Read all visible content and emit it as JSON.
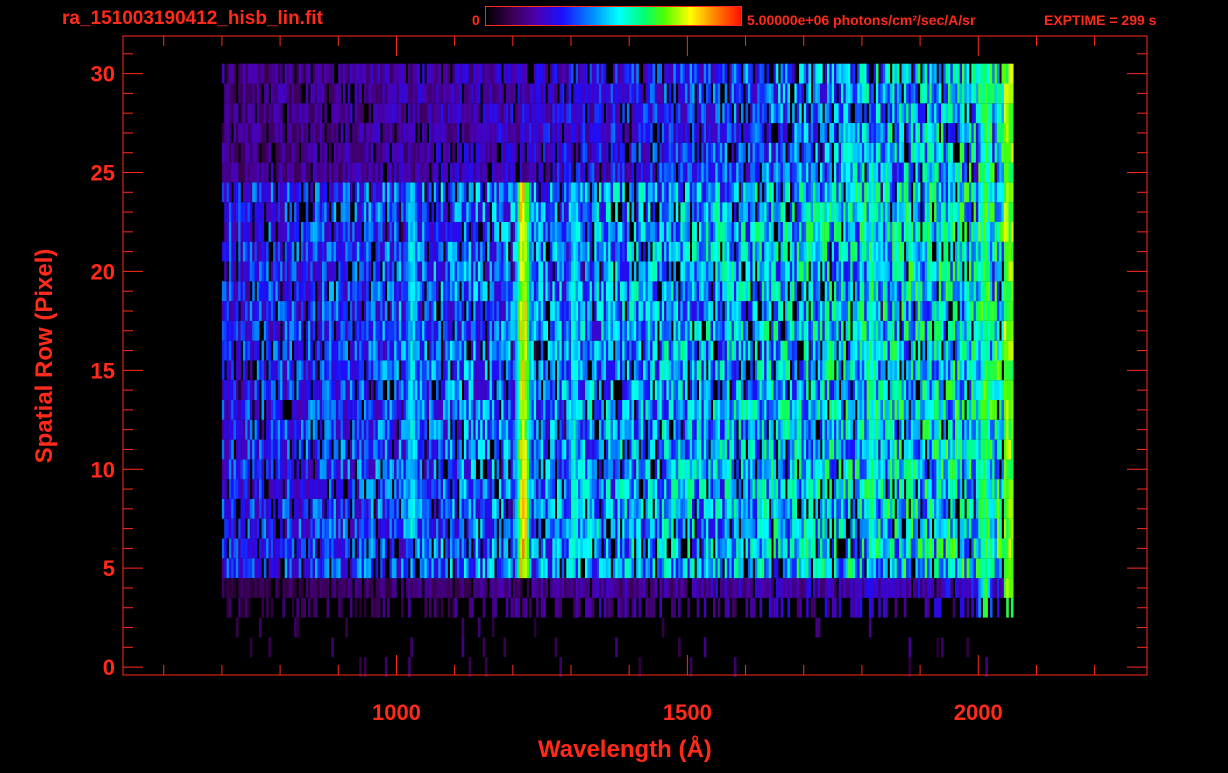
{
  "header": {
    "file_title": "ra_151003190412_hisb_lin.fit",
    "colorbar_min": "0",
    "colorbar_max": "5.00000e+06 photons/cm²/sec/A/sr",
    "exptime": "EXPTIME = 299 s"
  },
  "colors": {
    "text": "#ff2a1a",
    "axis": "#ff2a1a",
    "background": "#000000",
    "colormap": [
      "#000000",
      "#3a0050",
      "#4b00b4",
      "#1a10ff",
      "#0090ff",
      "#00ffff",
      "#00ff70",
      "#50ff00",
      "#ffff00",
      "#ff8000",
      "#ff1000"
    ]
  },
  "chart_data": {
    "type": "heatmap",
    "title": "ra_151003190412_hisb_lin.fit",
    "xlabel": "Wavelength (Å)",
    "ylabel": "Spatial Row (Pixel)",
    "xlim": [
      530,
      2290
    ],
    "ylim": [
      -0.4,
      31.9
    ],
    "x_ticks": [
      1000,
      1500,
      2000
    ],
    "x_tick_labels": [
      "1000",
      "1500",
      "2000"
    ],
    "x_minor_ticks": [
      600,
      700,
      800,
      900,
      1100,
      1200,
      1300,
      1400,
      1600,
      1700,
      1800,
      1900,
      2100,
      2200
    ],
    "y_ticks": [
      0,
      5,
      10,
      15,
      20,
      25,
      30
    ],
    "y_tick_labels": [
      "0",
      "5",
      "10",
      "15",
      "20",
      "25",
      "30"
    ],
    "y_minor_ticks": [
      1,
      2,
      3,
      4,
      6,
      7,
      8,
      9,
      11,
      12,
      13,
      14,
      16,
      17,
      18,
      19,
      21,
      22,
      23,
      24,
      26,
      27,
      28,
      29,
      31
    ],
    "colorbar_range": [
      0,
      5000000
    ],
    "colorbar_unit": "photons/cm²/sec/A/sr",
    "spectral_range_angstrom": [
      700,
      2060
    ],
    "bright_rows": [
      5,
      24
    ],
    "emission_features": [
      {
        "wavelength": 1025,
        "rows": [
          7,
          24
        ],
        "level": 0.48
      },
      {
        "wavelength": 1216,
        "rows": [
          5,
          24
        ],
        "level": 0.82
      },
      {
        "wavelength": 1304,
        "rows": [
          6,
          24
        ],
        "level": 0.5
      },
      {
        "wavelength": 1815,
        "rows": [
          6,
          24
        ],
        "level": 0.55
      },
      {
        "wavelength": 2010,
        "rows": [
          3,
          30
        ],
        "level": 0.62
      }
    ],
    "grid": false
  }
}
